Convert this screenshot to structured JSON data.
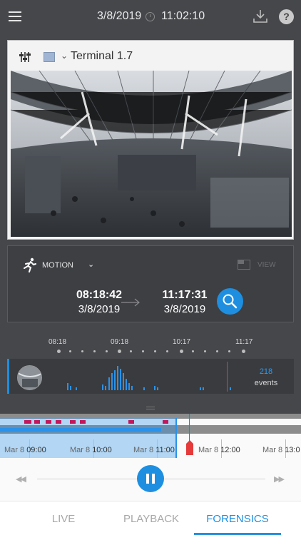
{
  "header": {
    "date": "3/8/2019",
    "time": "11:02:10",
    "icons": [
      "hamburger-menu-icon",
      "clock-icon",
      "download-icon",
      "help-icon"
    ],
    "help_label": "?"
  },
  "camera": {
    "name": "Terminal 1.7",
    "swatch_color": "#9fb5d3",
    "chevron": "⌄",
    "feed": "fisheye view of station concourse"
  },
  "search": {
    "filter_label": "MOTION",
    "chevron": "⌄",
    "view_label": "VIEW",
    "start_time": "08:18:42",
    "start_date": "3/8/2019",
    "end_time": "11:17:31",
    "end_date": "3/8/2019"
  },
  "event_ticks": [
    "08:18",
    "09:18",
    "10:17",
    "11:17"
  ],
  "events": {
    "count": "218",
    "label": "events"
  },
  "timeline": {
    "labels": [
      {
        "day": "Mar 8",
        "time": "09:00"
      },
      {
        "day": "Mar 8",
        "time": "10:00"
      },
      {
        "day": "Mar 8",
        "time": "11:00"
      },
      {
        "day": "Mar 8",
        "time": "12:00"
      },
      {
        "day": "Mar 8",
        "time": "13:0"
      }
    ]
  },
  "player": {
    "rewind": "◀◀",
    "fast_forward": "▶▶"
  },
  "tabs": [
    {
      "label": "LIVE",
      "active": false
    },
    {
      "label": "PLAYBACK",
      "active": false
    },
    {
      "label": "FORENSICS",
      "active": true
    }
  ],
  "colors": {
    "accent": "#1e8fe0",
    "marker": "#e53a3a",
    "event_mark": "#c3175b",
    "background": "#46474b"
  }
}
